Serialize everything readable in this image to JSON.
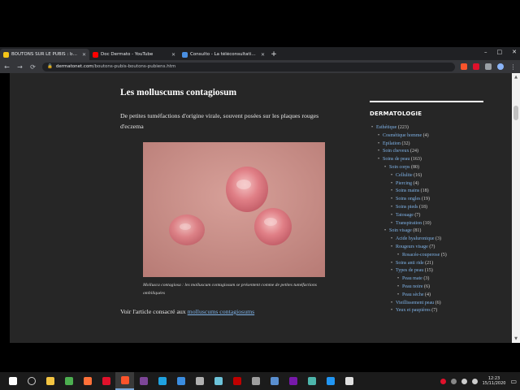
{
  "browser": {
    "tabs": [
      {
        "label": "BOUTONS SUR LE PUBIS : boutons",
        "color": "#f5c518",
        "active": true
      },
      {
        "label": "Doc Dermato - YouTube",
        "color": "#ff0000",
        "active": false
      },
      {
        "label": "Consulto - La téléconsultation mé",
        "color": "#4a90e2",
        "active": false
      }
    ],
    "new_tab": "+",
    "window_controls": [
      "–",
      "□",
      "✕"
    ],
    "address": {
      "host": "dermatonet.com",
      "path": "/boutons-pubis-boutons-pubiens.htm"
    },
    "nav": {
      "back": "←",
      "forward": "→",
      "reload": "⟳"
    }
  },
  "article": {
    "title": "Les molluscums contagiosum",
    "lead": "De petites tuméfactions d'origine virale, souvent posées sur les plaques rouges d'eczema",
    "caption": "Mollusca contagiosa : les molluscum contagiosum se présentent comme de petites tuméfactions ombiliquées",
    "more_prefix": "Voir l'article consacré aux ",
    "more_link": "molluscums contagiosums"
  },
  "sidebar": {
    "title": "DERMATOLOGIE",
    "categories": [
      {
        "label": "Esthétique",
        "count": "(223)",
        "level": 0
      },
      {
        "label": "Cosmétique homme",
        "count": "(4)",
        "level": 1
      },
      {
        "label": "Epilation",
        "count": "(32)",
        "level": 1
      },
      {
        "label": "Soin cheveux",
        "count": "(24)",
        "level": 1
      },
      {
        "label": "Soins de peau",
        "count": "(163)",
        "level": 1
      },
      {
        "label": "Soin corps",
        "count": "(80)",
        "level": 2
      },
      {
        "label": "Cellulite",
        "count": "(16)",
        "level": 3
      },
      {
        "label": "Piercing",
        "count": "(4)",
        "level": 3
      },
      {
        "label": "Soins mains",
        "count": "(18)",
        "level": 3
      },
      {
        "label": "Soins ongles",
        "count": "(19)",
        "level": 3
      },
      {
        "label": "Soins pieds",
        "count": "(18)",
        "level": 3
      },
      {
        "label": "Tatouage",
        "count": "(7)",
        "level": 3
      },
      {
        "label": "Transpiration",
        "count": "(10)",
        "level": 3
      },
      {
        "label": "Soin visage",
        "count": "(81)",
        "level": 2
      },
      {
        "label": "Acide hyaluronique",
        "count": "(3)",
        "level": 3
      },
      {
        "label": "Rougeurs visage",
        "count": "(7)",
        "level": 3
      },
      {
        "label": "Rosacée-couperose",
        "count": "(5)",
        "level": 4
      },
      {
        "label": "Soins anti ride",
        "count": "(21)",
        "level": 3
      },
      {
        "label": "Types de peau",
        "count": "(15)",
        "level": 3
      },
      {
        "label": "Peau mate",
        "count": "(3)",
        "level": 4
      },
      {
        "label": "Peau noire",
        "count": "(6)",
        "level": 4
      },
      {
        "label": "Peau sèche",
        "count": "(4)",
        "level": 4
      },
      {
        "label": "Vieillissement peau",
        "count": "(6)",
        "level": 3
      },
      {
        "label": "Yeux et paupières",
        "count": "(7)",
        "level": 3
      }
    ]
  },
  "taskbar": {
    "apps": [
      {
        "name": "windows-start-icon",
        "color": "#ffffff"
      },
      {
        "name": "search-icon",
        "color": "#cccccc"
      },
      {
        "name": "file-explorer-icon",
        "color": "#f4c542"
      },
      {
        "name": "chrome-icon",
        "color": "#4caf50"
      },
      {
        "name": "firefox-icon",
        "color": "#ff7139"
      },
      {
        "name": "opera-icon",
        "color": "#e0112b"
      },
      {
        "name": "brave-icon",
        "color": "#fb542b"
      },
      {
        "name": "tor-icon",
        "color": "#7d4698"
      },
      {
        "name": "edge-icon",
        "color": "#1fa2e0"
      },
      {
        "name": "mail-icon",
        "color": "#3b8de0"
      },
      {
        "name": "app-icon",
        "color": "#b0b0b0"
      },
      {
        "name": "app-icon-2",
        "color": "#6cc3d9"
      },
      {
        "name": "filezilla-icon",
        "color": "#bf0000"
      },
      {
        "name": "settings-icon",
        "color": "#9e9e9e"
      },
      {
        "name": "calculator-icon",
        "color": "#5a8fd0"
      },
      {
        "name": "onenote-icon",
        "color": "#7719aa"
      },
      {
        "name": "app-icon-3",
        "color": "#4db6ac"
      },
      {
        "name": "app-icon-4",
        "color": "#2196f3"
      },
      {
        "name": "app-icon-5",
        "color": "#e0e0e0"
      }
    ],
    "time": "12:23",
    "date": "15/11/2020"
  }
}
